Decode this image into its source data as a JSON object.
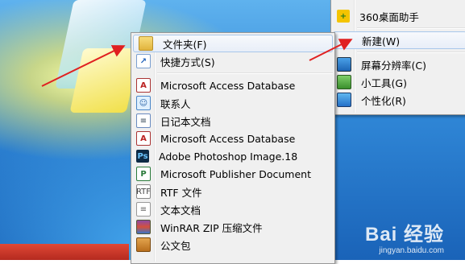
{
  "parent_menu": {
    "items": [
      {
        "label": "360桌面助手",
        "icon": "360-assistant-icon"
      },
      {
        "label": "新建(W)",
        "icon": "new-icon",
        "highlighted": true
      },
      {
        "label": "屏幕分辨率(C)",
        "icon": "screen-resolution-icon"
      },
      {
        "label": "小工具(G)",
        "icon": "gadgets-icon"
      },
      {
        "label": "个性化(R)",
        "icon": "personalize-icon"
      }
    ]
  },
  "sub_menu": {
    "items": [
      {
        "label": "文件夹(F)",
        "icon": "folder-icon",
        "highlighted": true
      },
      {
        "label": "快捷方式(S)",
        "icon": "shortcut-icon"
      },
      {
        "label": "Microsoft Access Database",
        "icon": "access-database-icon"
      },
      {
        "label": "联系人",
        "icon": "contact-icon"
      },
      {
        "label": "日记本文档",
        "icon": "journal-icon"
      },
      {
        "label": "Microsoft Access Database",
        "icon": "access-database-icon"
      },
      {
        "label": "Adobe Photoshop Image.18",
        "icon": "photoshop-icon"
      },
      {
        "label": "Microsoft Publisher Document",
        "icon": "publisher-icon"
      },
      {
        "label": "RTF 文件",
        "icon": "rtf-icon"
      },
      {
        "label": "文本文档",
        "icon": "text-document-icon"
      },
      {
        "label": "WinRAR ZIP 压缩文件",
        "icon": "winrar-icon"
      },
      {
        "label": "公文包",
        "icon": "briefcase-icon"
      }
    ]
  },
  "watermark": {
    "brand": "Bai 经验",
    "domain": "jingyan.baidu.com"
  },
  "colors": {
    "arrow": "#e02020",
    "highlight_border": "#a8c7ea"
  }
}
